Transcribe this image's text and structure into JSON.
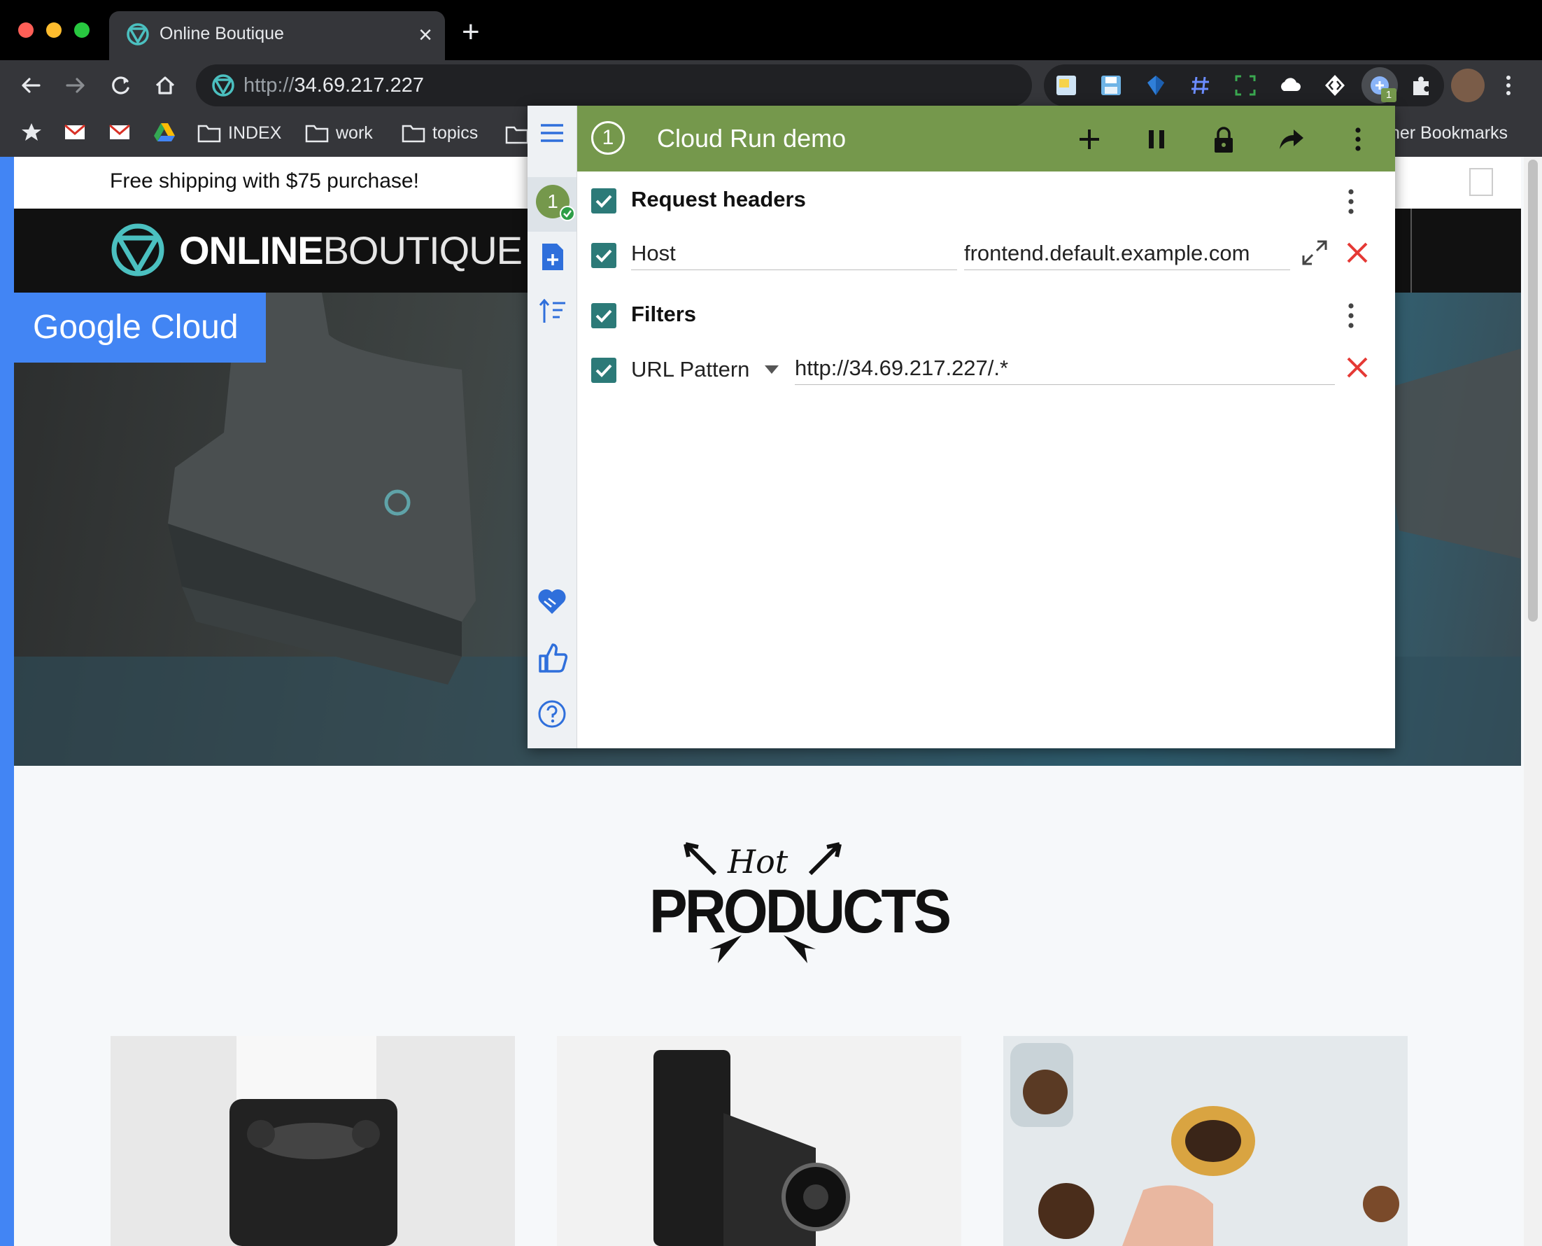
{
  "browser": {
    "tab_title": "Online Boutique",
    "tab_close": "×",
    "new_tab": "+",
    "url_prefix": "http://",
    "url_host": "34.69.217.227",
    "extension_badge": "1",
    "bookmarks": [
      "INDEX",
      "work",
      "topics"
    ],
    "other_bookmarks": "ther Bookmarks"
  },
  "page": {
    "shipping_text": "Free shipping with $75 purchase!",
    "logo_bold": "ONLINE",
    "logo_light": "BOUTIQUE",
    "hero_badge": "Google Cloud",
    "hot_script": "Hot",
    "hot_products": "PRODUCTS"
  },
  "popup": {
    "profile_number": "1",
    "profile_title": "Cloud Run demo",
    "sections": {
      "request_headers": "Request headers",
      "filters": "Filters"
    },
    "header_row": {
      "name": "Host",
      "value": "frontend.default.example.com"
    },
    "filter_row": {
      "type": "URL Pattern",
      "value": "http://34.69.217.227/.*"
    },
    "colors": {
      "header_green": "#75984c",
      "checkbox_teal": "#2c7a78",
      "delete_red": "#e53935",
      "side_icon_blue": "#2f6fdb"
    }
  }
}
